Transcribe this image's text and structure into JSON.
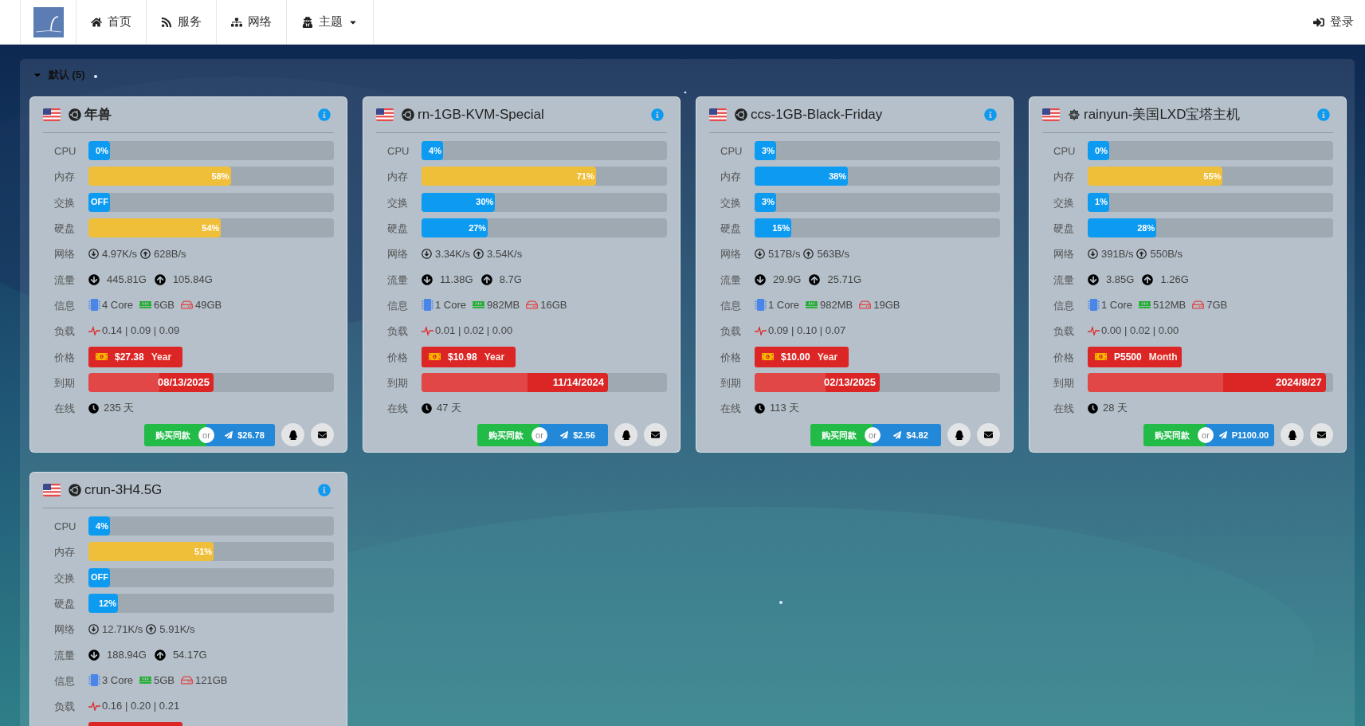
{
  "nav": {
    "items": [
      {
        "label": "首页",
        "dropdown": false
      },
      {
        "label": "服务",
        "dropdown": false
      },
      {
        "label": "网络",
        "dropdown": false
      },
      {
        "label": "主题",
        "dropdown": true
      }
    ],
    "login": "登录"
  },
  "group": {
    "title": "默认 (5)",
    "expanded": true,
    "cards": [
      {
        "ubuntu_logo": true,
        "name": "年兽",
        "rows": [
          {
            "kind": "bar",
            "label": "CPU",
            "text": "0%",
            "level": 0,
            "color": "#0d9bf2"
          },
          {
            "kind": "bar",
            "label": "内存",
            "text": "58%",
            "level": 0.58,
            "color": "#f0bf3a"
          },
          {
            "kind": "bar",
            "label": "交换",
            "text": "OFF",
            "level": 0,
            "color": "#0d9bf2"
          },
          {
            "kind": "bar",
            "label": "硬盘",
            "text": "54%",
            "level": 0.54,
            "color": "#f0bf3a"
          },
          {
            "kind": "net",
            "label": "网络",
            "down": "4.97K/s",
            "up": "628B/s"
          },
          {
            "kind": "traffic",
            "label": "流量",
            "down": "445.81G",
            "up": "105.84G"
          },
          {
            "kind": "info",
            "label": "信息",
            "cpu": "4 Core",
            "memory": "6GB",
            "disk": "49GB"
          },
          {
            "kind": "load",
            "label": "负载",
            "text": "0.14 | 0.09 | 0.09"
          },
          {
            "kind": "price",
            "label": "价格",
            "amount": "$27.38",
            "period": "Year"
          },
          {
            "kind": "expiry",
            "label": "到期",
            "text": "08/13/2025",
            "level": 0.51
          },
          {
            "kind": "uptime",
            "label": "在线",
            "text": "235 天"
          }
        ],
        "actions": {
          "buy": "购买同款",
          "or": "or",
          "aff": "$26.78"
        }
      },
      {
        "ubuntu_logo": true,
        "name": "rn-1GB-KVM-Special",
        "rows": [
          {
            "kind": "bar",
            "label": "CPU",
            "text": "4%",
            "level": 0.04,
            "color": "#0d9bf2"
          },
          {
            "kind": "bar",
            "label": "内存",
            "text": "71%",
            "level": 0.71,
            "color": "#f0bf3a"
          },
          {
            "kind": "bar",
            "label": "交换",
            "text": "30%",
            "level": 0.3,
            "color": "#0d9bf2"
          },
          {
            "kind": "bar",
            "label": "硬盘",
            "text": "27%",
            "level": 0.27,
            "color": "#0d9bf2"
          },
          {
            "kind": "net",
            "label": "网络",
            "down": "3.34K/s",
            "up": "3.54K/s"
          },
          {
            "kind": "traffic",
            "label": "流量",
            "down": "11.38G",
            "up": "8.7G"
          },
          {
            "kind": "info",
            "label": "信息",
            "cpu": "1 Core",
            "memory": "982MB",
            "disk": "16GB"
          },
          {
            "kind": "load",
            "label": "负载",
            "text": "0.01 | 0.02 | 0.00"
          },
          {
            "kind": "price",
            "label": "价格",
            "amount": "$10.98",
            "period": "Year"
          },
          {
            "kind": "expiry",
            "label": "到期",
            "text": "11/14/2024",
            "level": 0.76
          },
          {
            "kind": "uptime",
            "label": "在线",
            "text": "47 天"
          }
        ],
        "actions": {
          "buy": "购买同款",
          "or": "or",
          "aff": "$2.56"
        }
      },
      {
        "ubuntu_logo": true,
        "name": "ccs-1GB-Black-Friday",
        "rows": [
          {
            "kind": "bar",
            "label": "CPU",
            "text": "3%",
            "level": 0.03,
            "color": "#0d9bf2"
          },
          {
            "kind": "bar",
            "label": "内存",
            "text": "38%",
            "level": 0.38,
            "color": "#0d9bf2"
          },
          {
            "kind": "bar",
            "label": "交换",
            "text": "3%",
            "level": 0.03,
            "color": "#0d9bf2"
          },
          {
            "kind": "bar",
            "label": "硬盘",
            "text": "15%",
            "level": 0.15,
            "color": "#0d9bf2"
          },
          {
            "kind": "net",
            "label": "网络",
            "down": "517B/s",
            "up": "563B/s"
          },
          {
            "kind": "traffic",
            "label": "流量",
            "down": "29.9G",
            "up": "25.71G"
          },
          {
            "kind": "info",
            "label": "信息",
            "cpu": "1 Core",
            "memory": "982MB",
            "disk": "19GB"
          },
          {
            "kind": "load",
            "label": "负载",
            "text": "0.09 | 0.10 | 0.07"
          },
          {
            "kind": "price",
            "label": "价格",
            "amount": "$10.00",
            "period": "Year"
          },
          {
            "kind": "expiry",
            "label": "到期",
            "text": "02/13/2025",
            "level": 0.51
          },
          {
            "kind": "uptime",
            "label": "在线",
            "text": "113 天"
          }
        ],
        "actions": {
          "buy": "购买同款",
          "or": "or",
          "aff": "$4.82"
        }
      },
      {
        "ubuntu_logo": false,
        "name": "rainyun-美国LXD宝塔主机",
        "rows": [
          {
            "kind": "bar",
            "label": "CPU",
            "text": "0%",
            "level": 0,
            "color": "#0d9bf2"
          },
          {
            "kind": "bar",
            "label": "内存",
            "text": "55%",
            "level": 0.55,
            "color": "#f0bf3a"
          },
          {
            "kind": "bar",
            "label": "交换",
            "text": "1%",
            "level": 0.01,
            "color": "#0d9bf2"
          },
          {
            "kind": "bar",
            "label": "硬盘",
            "text": "28%",
            "level": 0.28,
            "color": "#0d9bf2"
          },
          {
            "kind": "net",
            "label": "网络",
            "down": "391B/s",
            "up": "550B/s"
          },
          {
            "kind": "traffic",
            "label": "流量",
            "down": "3.85G",
            "up": "1.26G"
          },
          {
            "kind": "info",
            "label": "信息",
            "cpu": "1 Core",
            "memory": "512MB",
            "disk": "7GB"
          },
          {
            "kind": "load",
            "label": "负载",
            "text": "0.00 | 0.02 | 0.00"
          },
          {
            "kind": "price",
            "label": "价格",
            "amount": "P5500",
            "period": "Month"
          },
          {
            "kind": "expiry",
            "label": "到期",
            "text": "2024/8/27",
            "level": 0.97
          },
          {
            "kind": "uptime",
            "label": "在线",
            "text": "28 天"
          }
        ],
        "actions": {
          "buy": "购买同款",
          "or": "or",
          "aff": "P1100.00"
        }
      },
      {
        "ubuntu_logo": true,
        "name": "crun-3H4.5G",
        "rows": [
          {
            "kind": "bar",
            "label": "CPU",
            "text": "4%",
            "level": 0.04,
            "color": "#0d9bf2"
          },
          {
            "kind": "bar",
            "label": "内存",
            "text": "51%",
            "level": 0.51,
            "color": "#f0bf3a"
          },
          {
            "kind": "bar",
            "label": "交换",
            "text": "OFF",
            "level": 0,
            "color": "#0d9bf2"
          },
          {
            "kind": "bar",
            "label": "硬盘",
            "text": "12%",
            "level": 0.12,
            "color": "#0d9bf2"
          },
          {
            "kind": "net",
            "label": "网络",
            "down": "12.71K/s",
            "up": "5.91K/s"
          },
          {
            "kind": "traffic",
            "label": "流量",
            "down": "188.94G",
            "up": "54.17G"
          },
          {
            "kind": "info",
            "label": "信息",
            "cpu": "3 Core",
            "memory": "5GB",
            "disk": "121GB"
          },
          {
            "kind": "load",
            "label": "负载",
            "text": "0.16 | 0.20 | 0.21"
          },
          {
            "kind": "price"
          }
        ]
      }
    ]
  }
}
